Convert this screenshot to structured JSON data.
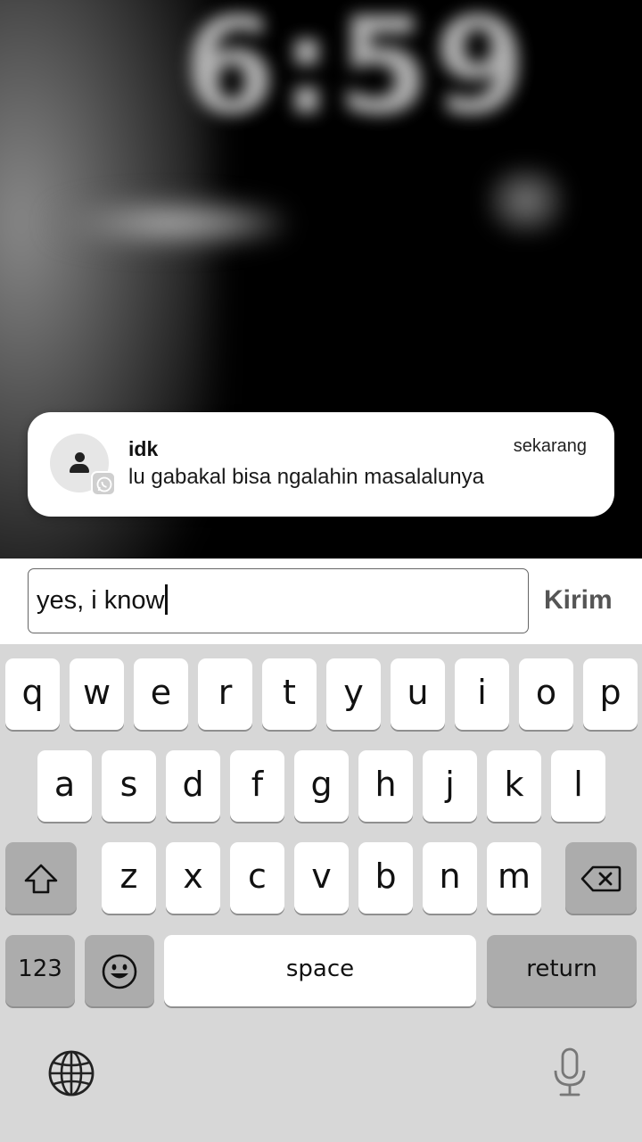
{
  "wallpaper": {
    "clock_text": "6:59"
  },
  "notification": {
    "sender": "idk",
    "time": "sekarang",
    "message": "lu gabakal bisa ngalahin masalalunya",
    "avatar_icon": "person-icon",
    "app_badge_icon": "whatsapp-icon"
  },
  "reply": {
    "input_value": "yes, i know",
    "send_label": "Kirim"
  },
  "keyboard": {
    "row1": [
      "q",
      "w",
      "e",
      "r",
      "t",
      "y",
      "u",
      "i",
      "o",
      "p"
    ],
    "row2": [
      "a",
      "s",
      "d",
      "f",
      "g",
      "h",
      "j",
      "k",
      "l"
    ],
    "row3": [
      "z",
      "x",
      "c",
      "v",
      "b",
      "n",
      "m"
    ],
    "shift_icon": "shift-icon",
    "delete_icon": "backspace-icon",
    "numbers_label": "123",
    "emoji_icon": "emoji-icon",
    "space_label": "space",
    "return_label": "return",
    "globe_icon": "globe-icon",
    "mic_icon": "microphone-icon"
  },
  "colors": {
    "keyboard_bg": "#d7d7d7",
    "key_light": "#ffffff",
    "key_dark": "#acacac",
    "send_text": "#555555"
  }
}
